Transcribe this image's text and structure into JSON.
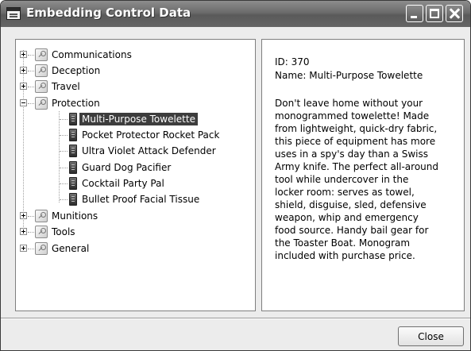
{
  "window": {
    "title": "Embedding Control Data"
  },
  "tree": {
    "categories": [
      {
        "label": "Communications",
        "expanded": false,
        "icon": "key-icon"
      },
      {
        "label": "Deception",
        "expanded": false,
        "icon": "key-icon"
      },
      {
        "label": "Travel",
        "expanded": false,
        "icon": "key-icon"
      },
      {
        "label": "Protection",
        "expanded": true,
        "icon": "key-icon"
      },
      {
        "label": "Munitions",
        "expanded": false,
        "icon": "key-icon"
      },
      {
        "label": "Tools",
        "expanded": false,
        "icon": "key-icon"
      },
      {
        "label": "General",
        "expanded": false,
        "icon": "key-icon"
      }
    ],
    "protection_items": [
      {
        "label": "Multi-Purpose Towelette",
        "selected": true,
        "icon": "gadget-icon"
      },
      {
        "label": "Pocket Protector Rocket Pack",
        "selected": false,
        "icon": "gadget-icon"
      },
      {
        "label": "Ultra Violet Attack Defender",
        "selected": false,
        "icon": "gadget-icon"
      },
      {
        "label": "Guard Dog Pacifier",
        "selected": false,
        "icon": "gadget-icon"
      },
      {
        "label": "Cocktail Party Pal",
        "selected": false,
        "icon": "gadget-icon"
      },
      {
        "label": "Bullet Proof Facial Tissue",
        "selected": false,
        "icon": "gadget-icon"
      }
    ]
  },
  "detail": {
    "id_line": "ID: 370",
    "name_line": "Name: Multi-Purpose Towelette",
    "description": "Don't leave home without your\nmonogrammed towelette! Made\nfrom lightweight, quick-dry fabric,\nthis piece of equipment has more\nuses in a spy's day than a Swiss\nArmy knife. The perfect all-around\ntool while undercover in the\nlocker room: serves as towel,\nshield, disguise, sled, defensive\nweapon, whip and emergency\nfood source. Handy bail gear for\nthe Toaster Boat. Monogram\nincluded with purchase price."
  },
  "buttons": {
    "close_label": "Close"
  },
  "colors": {
    "selection_bg": "#3d3d3d",
    "titlebar": "#6b6b6b"
  }
}
